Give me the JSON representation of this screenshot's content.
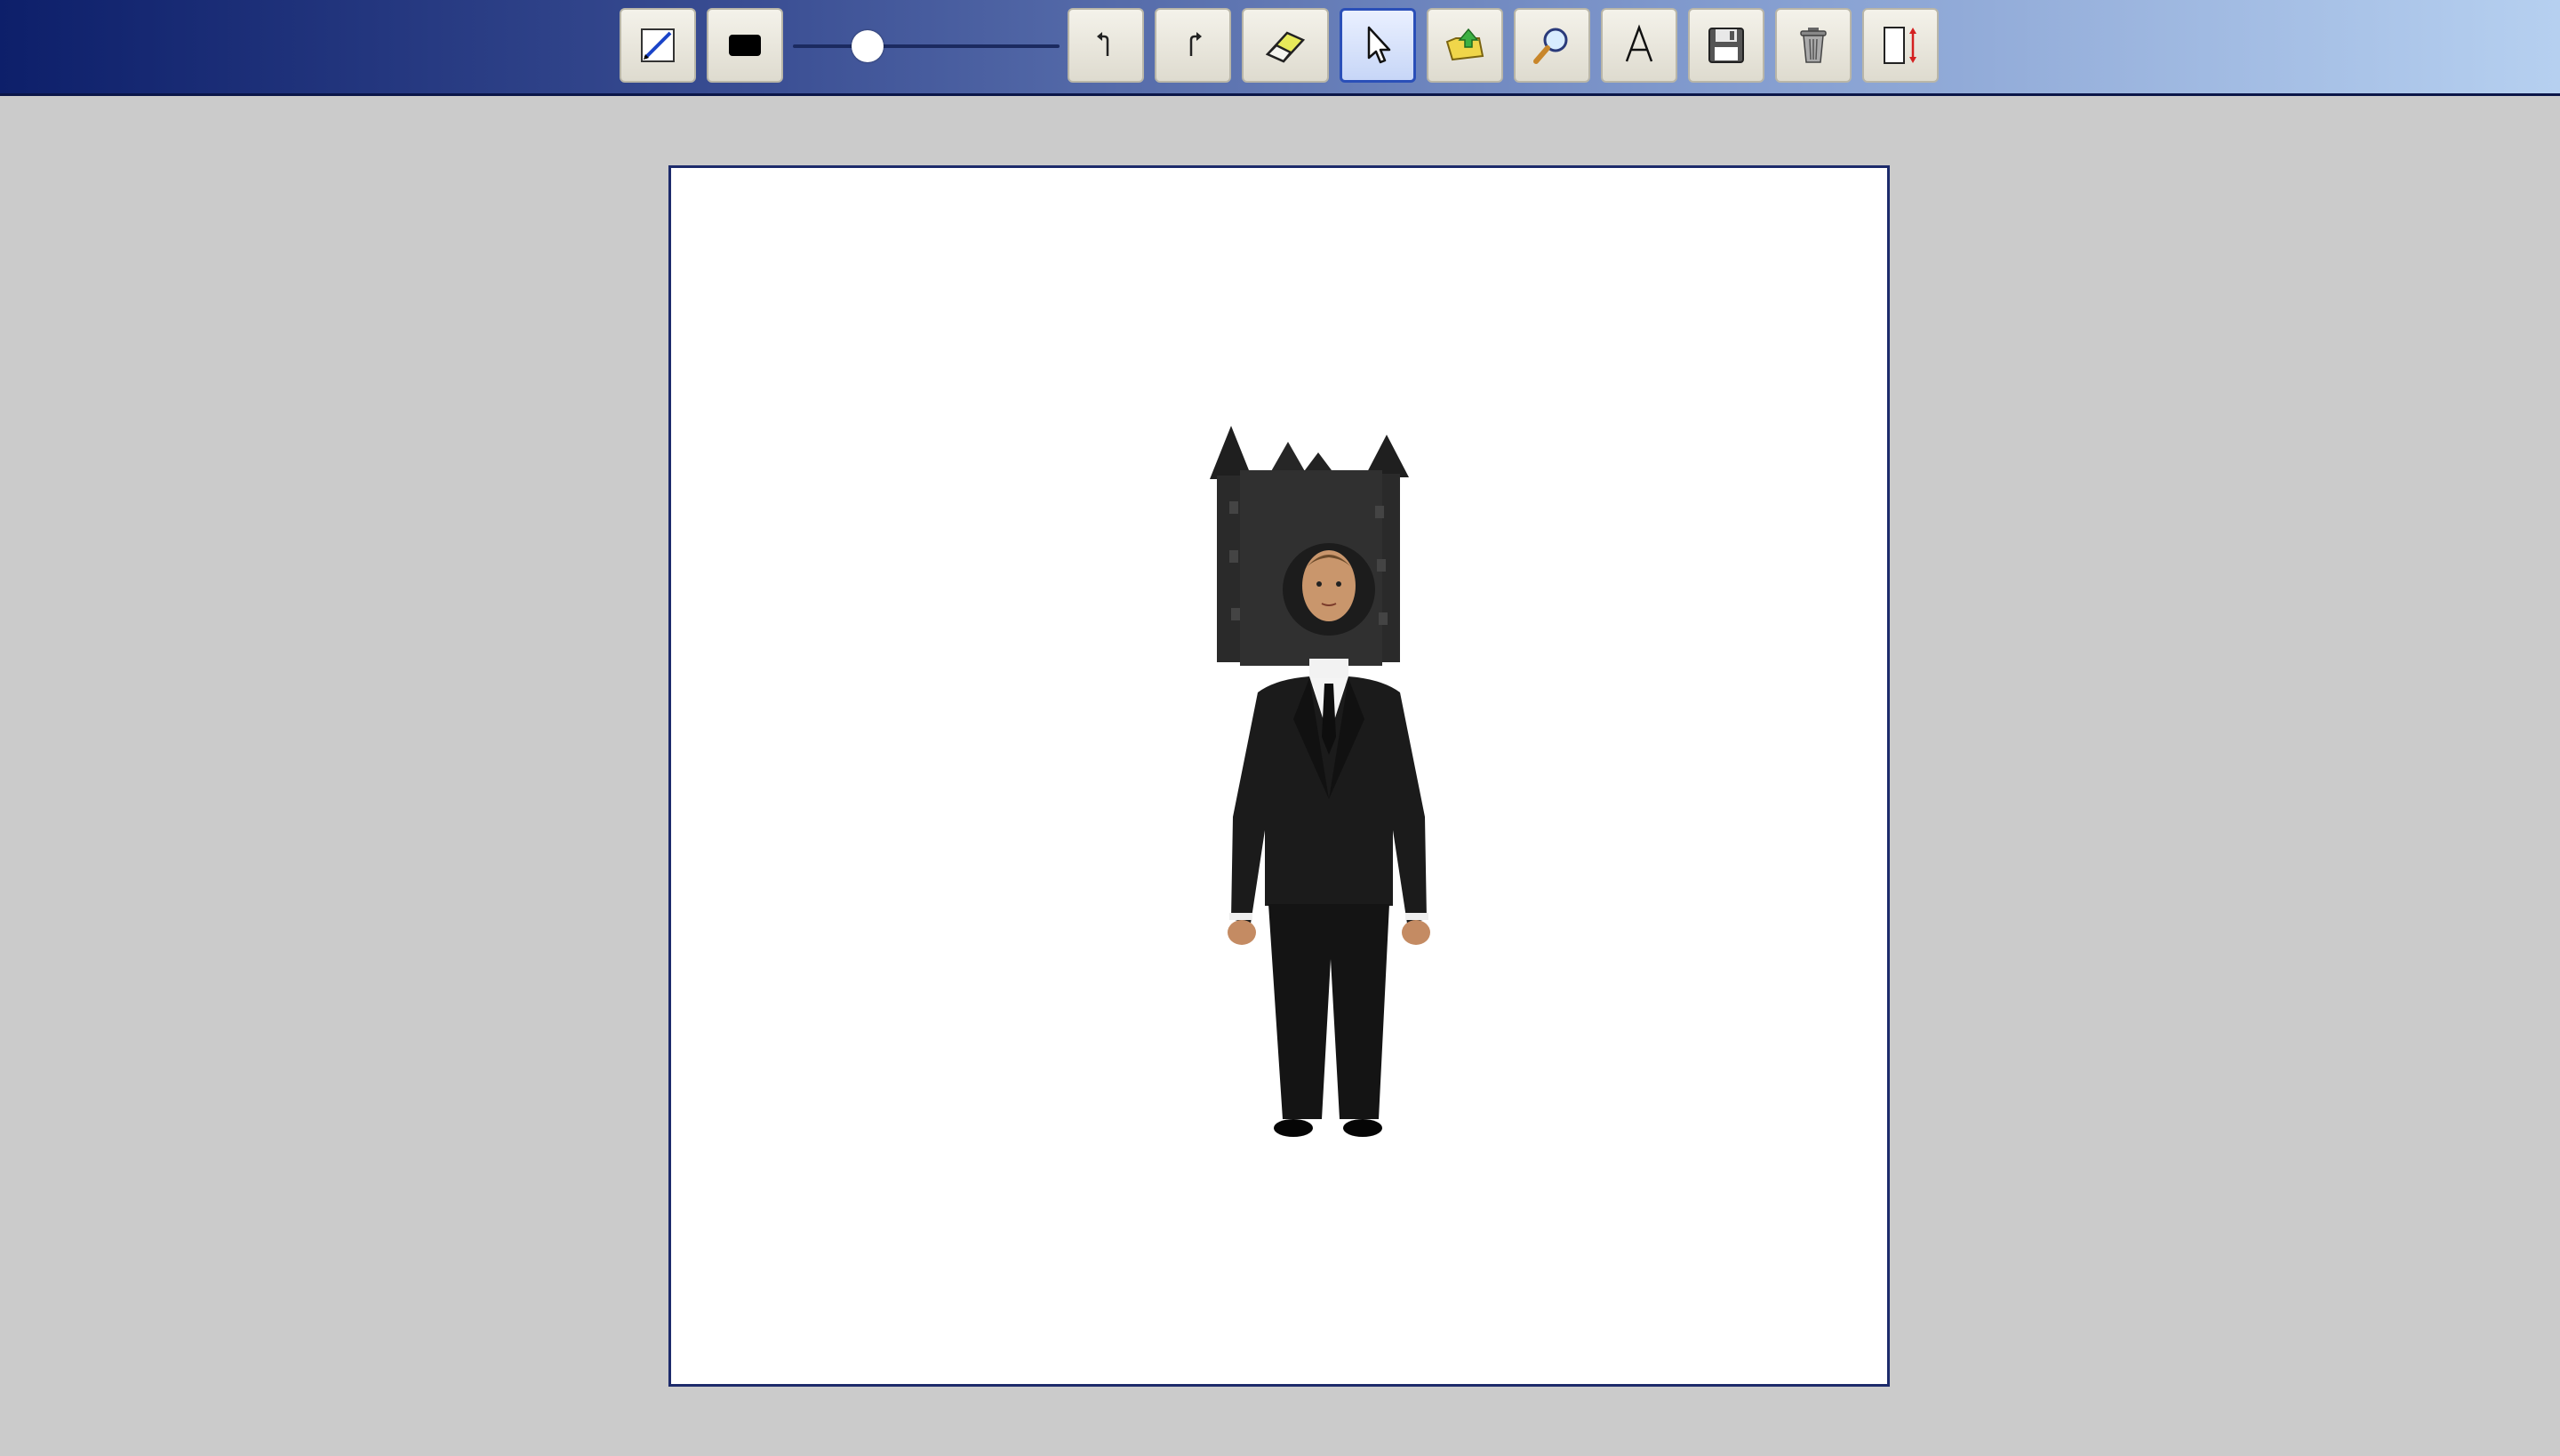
{
  "toolbar": {
    "tools": [
      {
        "id": "pencil",
        "icon": "pencil-icon",
        "active": false
      },
      {
        "id": "color",
        "icon": "color-swatch-icon",
        "color": "#000000",
        "active": false
      },
      {
        "id": "undo",
        "icon": "undo-icon",
        "active": false
      },
      {
        "id": "redo",
        "icon": "redo-icon",
        "active": false
      },
      {
        "id": "eraser",
        "icon": "eraser-icon",
        "active": false
      },
      {
        "id": "select",
        "icon": "pointer-icon",
        "active": true
      },
      {
        "id": "open",
        "icon": "open-folder-icon",
        "active": false
      },
      {
        "id": "zoom",
        "icon": "magnifier-icon",
        "active": false
      },
      {
        "id": "text",
        "icon": "text-icon",
        "active": false
      },
      {
        "id": "save",
        "icon": "floppy-disk-icon",
        "active": false
      },
      {
        "id": "clear",
        "icon": "trash-can-icon",
        "active": false
      },
      {
        "id": "resize",
        "icon": "resize-canvas-icon",
        "active": false
      }
    ],
    "brush_size": {
      "value_fraction": 0.28,
      "icon": "slider-thumb"
    }
  },
  "colors": {
    "toolbar_gradient_start": "#0d1f6a",
    "toolbar_gradient_end": "#b6d0f0",
    "background": "#cbcbcb",
    "canvas": "#ffffff",
    "active_tool_border": "#2a4fb8",
    "current_brush_color": "#000000"
  },
  "canvas": {
    "content": "photo-person-in-black-suit-with-castle-headpiece"
  }
}
